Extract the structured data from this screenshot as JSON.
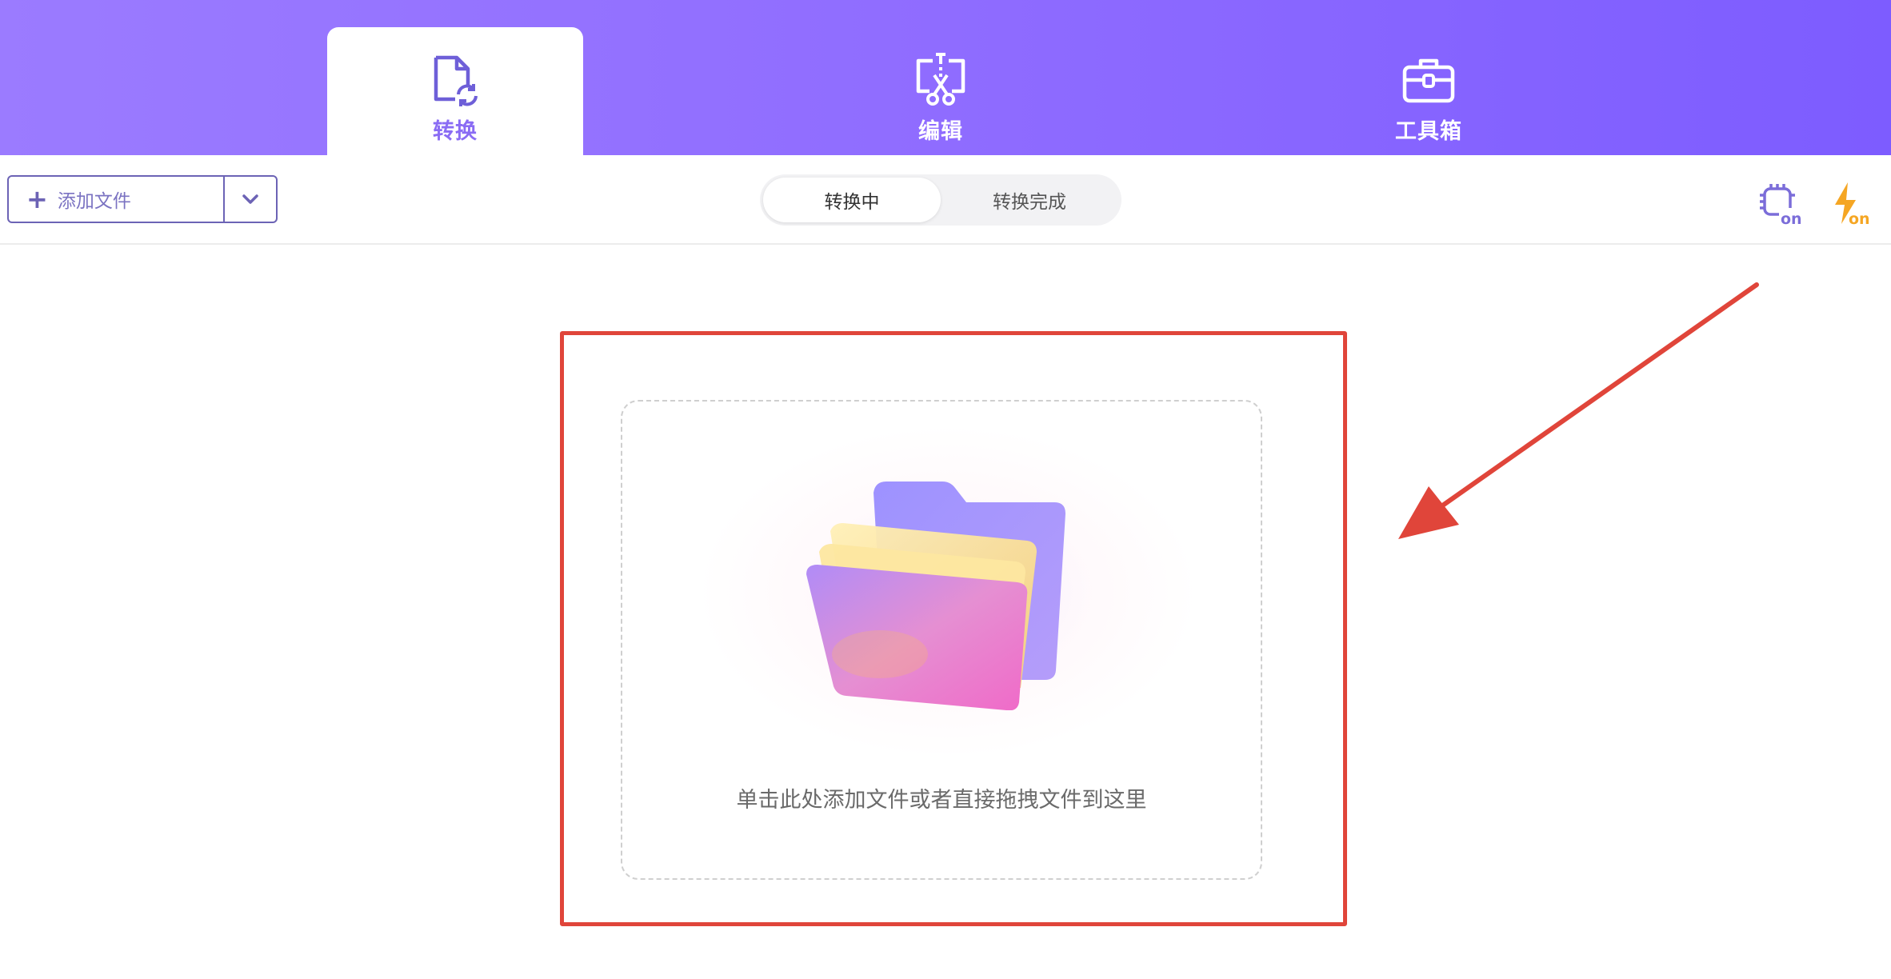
{
  "header": {
    "tabs": [
      {
        "label": "转换",
        "icon": "file-convert-icon",
        "active": true
      },
      {
        "label": "编辑",
        "icon": "edit-cut-icon",
        "active": false
      },
      {
        "label": "工具箱",
        "icon": "toolbox-icon",
        "active": false
      }
    ]
  },
  "toolbar": {
    "add_file": {
      "plus": "+",
      "label": "添加文件",
      "dropdown_icon": "chevron-down-icon"
    },
    "status_tabs": [
      {
        "label": "转换中",
        "active": true
      },
      {
        "label": "转换完成",
        "active": false
      }
    ],
    "right_icons": [
      {
        "name": "gpu-acceleration-on-icon",
        "text": "on"
      },
      {
        "name": "fast-mode-on-icon",
        "text": "on"
      }
    ]
  },
  "drop_zone": {
    "text": "单击此处添加文件或者直接拖拽文件到这里",
    "icon": "folder-icon"
  },
  "colors": {
    "header_start": "#9b7bff",
    "header_end": "#7d5cff",
    "accent": "#8a6cf4",
    "highlight_border": "#e0453a",
    "lightning": "#f5a623"
  }
}
